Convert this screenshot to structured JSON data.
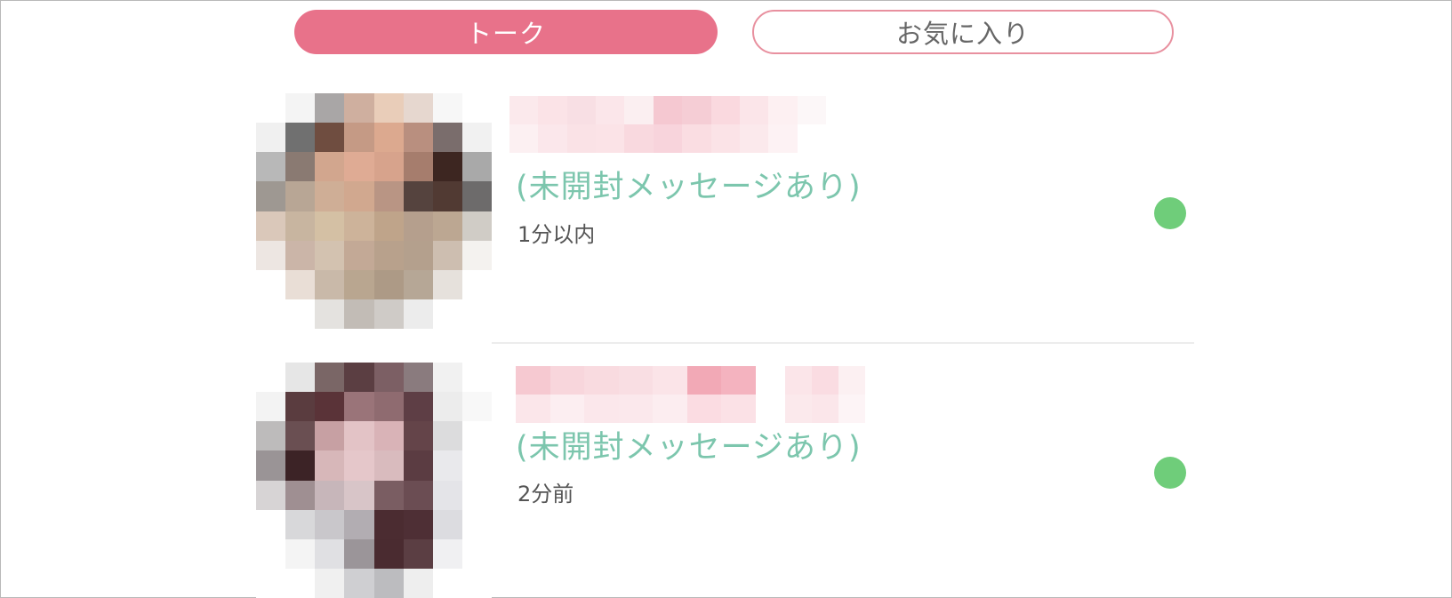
{
  "tabs": {
    "talk": "トーク",
    "favorites": "お気に入り"
  },
  "colors": {
    "accent": "#e8728a",
    "unread_text": "#7cc6ad",
    "online": "#6fcd7a",
    "time_text": "#555555"
  },
  "conversations": [
    {
      "status_text": "(未開封メッセージあり)",
      "time": "1分以内",
      "online": true
    },
    {
      "status_text": "(未開封メッセージあり)",
      "time": "2分前",
      "online": true
    }
  ]
}
